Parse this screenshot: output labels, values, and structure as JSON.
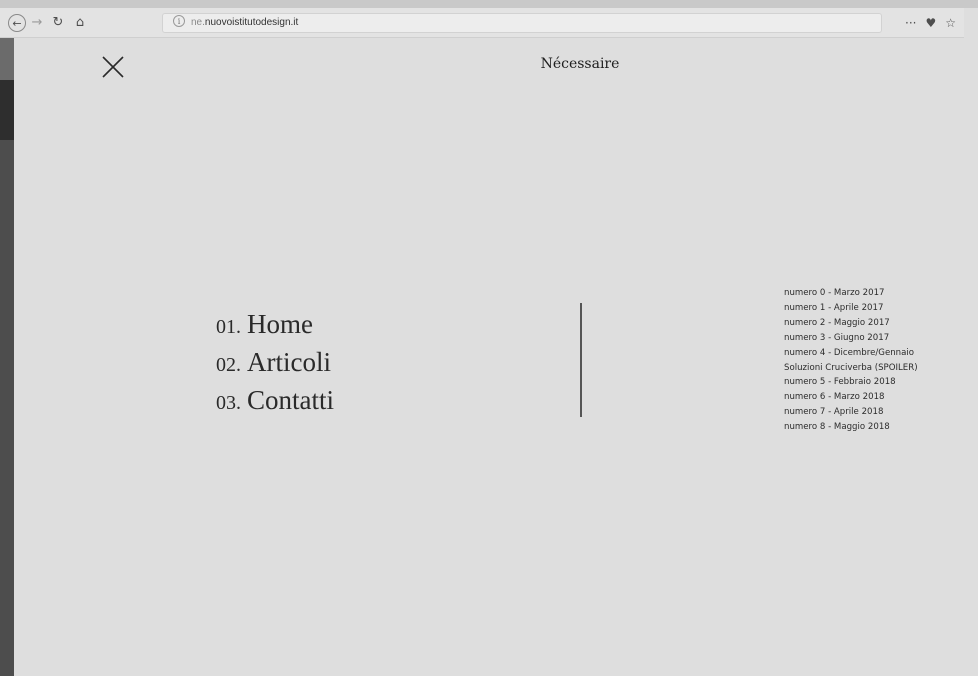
{
  "browser": {
    "url_prefix": "ne.",
    "url_domain": "nuovoistitutodesign.it",
    "icons": [
      "back-icon",
      "forward-icon",
      "reload-icon",
      "home-icon",
      "info-icon",
      "more-icon",
      "pocket-icon",
      "bookmark-star-icon"
    ],
    "glyphs": {
      "back": "←",
      "forward": "→",
      "reload": "↻",
      "home": "⌂",
      "info": "i",
      "more": "···",
      "pocket": "♥",
      "star": "☆"
    }
  },
  "page": {
    "title": "Nécessaire",
    "nav": [
      {
        "num": "01.",
        "label": "Home"
      },
      {
        "num": "02.",
        "label": "Articoli"
      },
      {
        "num": "03.",
        "label": "Contatti"
      }
    ],
    "issues": [
      "numero 0 - Marzo 2017",
      "numero 1 - Aprile 2017",
      "numero 2 - Maggio 2017",
      "numero 3 - Giugno 2017",
      "numero 4 - Dicembre/Gennaio",
      "Soluzioni Cruciverba (SPOILER)",
      "numero 5 - Febbraio 2018",
      "numero 6 - Marzo 2018",
      "numero 7 - Aprile 2018",
      "numero 8 - Maggio 2018"
    ]
  },
  "colors": {
    "page_background": "#dedede",
    "text": "#2a2a2a",
    "divider": "#555555"
  }
}
